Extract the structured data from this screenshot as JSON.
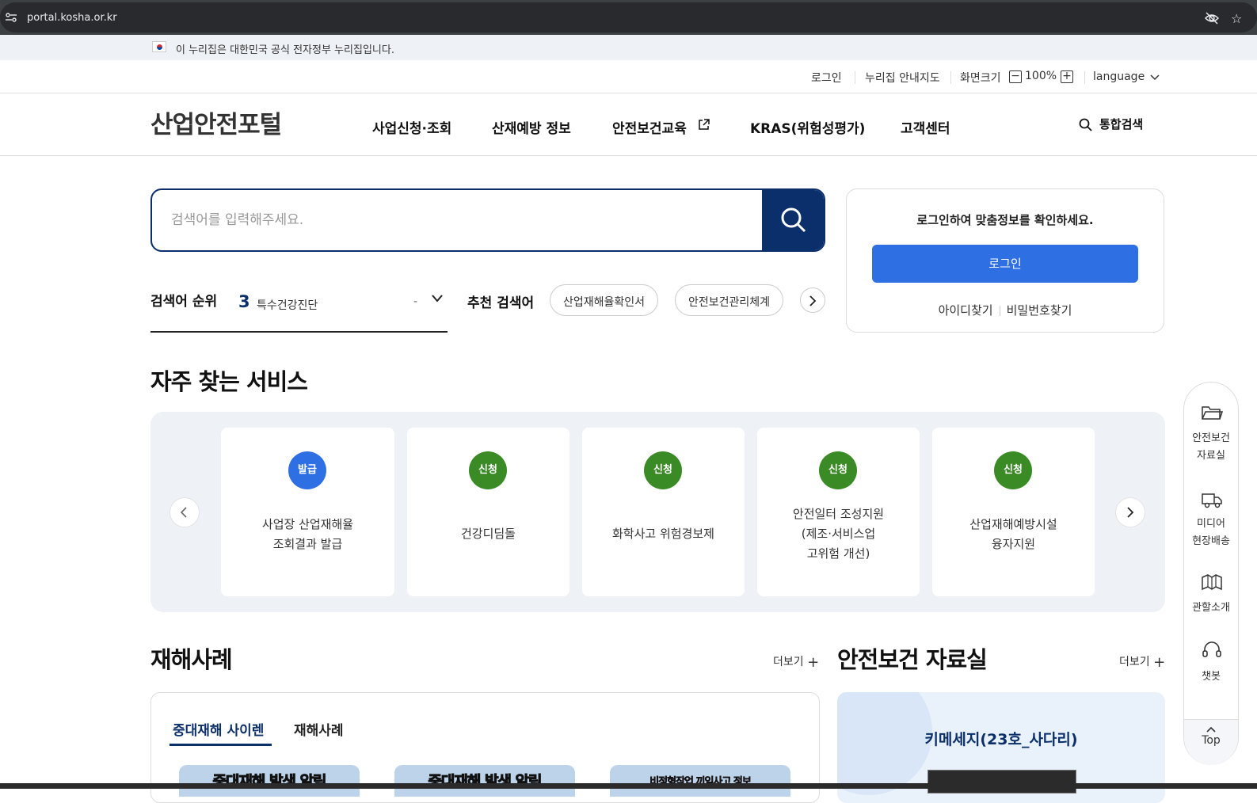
{
  "browser": {
    "url": "portal.kosha.or.kr"
  },
  "gov_banner": {
    "text": "이 누리집은 대한민국 공식 전자정부 누리집입니다."
  },
  "utility": {
    "login": "로그인",
    "sitemap": "누리집 안내지도",
    "zoom_label": "화면크기",
    "zoom_minus": "−",
    "zoom_value": "100%",
    "zoom_plus": "+",
    "language": "language"
  },
  "header": {
    "logo": "산업안전포털",
    "nav": [
      "사업신청·조회",
      "산재예방 정보",
      "안전보건교육",
      "KRAS(위험성평가)",
      "고객센터"
    ],
    "search_label": "통합검색"
  },
  "search": {
    "placeholder": "검색어를 입력해주세요.",
    "rank_label": "검색어 순위",
    "rank_number": "3",
    "rank_term": "특수건강진단",
    "rank_change": "-",
    "recommend_label": "추천 검색어",
    "recommend_chips": [
      "산업재해율확인서",
      "안전보건관리체계"
    ]
  },
  "login_card": {
    "message": "로그인하여 맞춤정보를 확인하세요.",
    "button": "로그인",
    "find_id": "아이디찾기",
    "find_pw": "비밀번호찾기"
  },
  "services": {
    "title": "자주 찾는 서비스",
    "items": [
      {
        "badge": "발급",
        "badge_color": "#2f6fe4",
        "lines": [
          "사업장 산업재해율",
          "조회결과 발급"
        ]
      },
      {
        "badge": "신청",
        "badge_color": "#3a8a26",
        "lines": [
          "건강디딤돌"
        ]
      },
      {
        "badge": "신청",
        "badge_color": "#3a8a26",
        "lines": [
          "화학사고 위험경보제"
        ]
      },
      {
        "badge": "신청",
        "badge_color": "#3a8a26",
        "lines": [
          "안전일터 조성지원",
          "(제조·서비스업",
          "고위험 개선)"
        ]
      },
      {
        "badge": "신청",
        "badge_color": "#3a8a26",
        "lines": [
          "산업재해예방시설",
          "융자지원"
        ]
      }
    ]
  },
  "cases": {
    "title": "재해사례",
    "more": "더보기",
    "tabs": [
      "중대재해 사이렌",
      "재해사례"
    ],
    "thumbs": [
      "중대재해 발생 알림",
      "중대재해 발생 알림",
      "비정형작업 끼임사고 정보"
    ]
  },
  "resources": {
    "title": "안전보건 자료실",
    "more": "더보기",
    "card_title": "키메세지(23호_사다리)"
  },
  "quick_menu": {
    "items": [
      {
        "icon": "folder-icon",
        "lines": [
          "안전보건",
          "자료실"
        ]
      },
      {
        "icon": "truck-icon",
        "lines": [
          "미디어",
          "현장배송"
        ]
      },
      {
        "icon": "map-icon",
        "lines": [
          "관할소개"
        ]
      },
      {
        "icon": "headset-icon",
        "lines": [
          "챗봇"
        ]
      }
    ],
    "top": "Top"
  }
}
